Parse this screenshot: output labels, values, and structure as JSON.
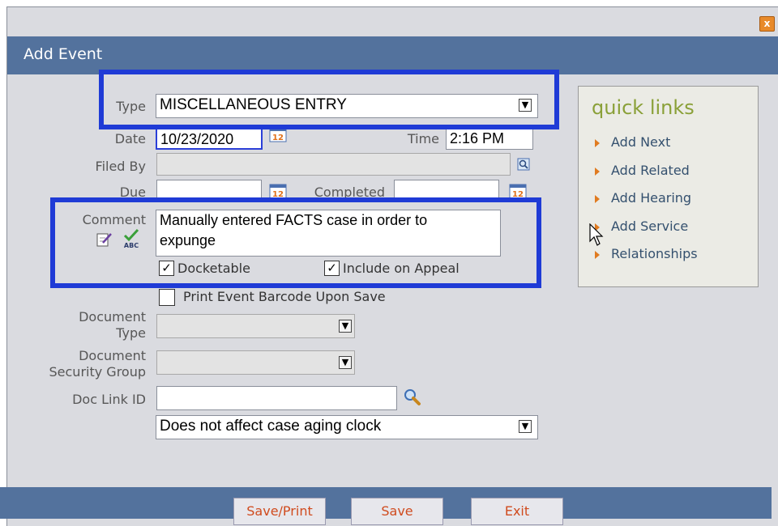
{
  "dialog": {
    "title": "Add Event",
    "close_glyph": "x"
  },
  "form": {
    "type_label": "Type",
    "type_value": "MISCELLANEOUS ENTRY",
    "date_label": "Date",
    "date_value": "10/23/2020",
    "time_label": "Time",
    "time_value": "2:16 PM",
    "filed_by_label": "Filed By",
    "filed_by_value": "",
    "due_label": "Due",
    "due_value": "",
    "completed_label": "Completed",
    "completed_value": "",
    "comment_label": "Comment",
    "comment_line1": "Manually entered FACTS case in order to",
    "comment_line2": "expunge",
    "docketable_label": "Docketable",
    "docketable_checked": true,
    "include_appeal_label": "Include on Appeal",
    "include_appeal_checked": true,
    "print_barcode_label": "Print Event Barcode Upon Save",
    "print_barcode_checked": false,
    "doc_type_label_1": "Document",
    "doc_type_label_2": "Type",
    "doc_type_value": "",
    "doc_sec_label_1": "Document",
    "doc_sec_label_2": "Security Group",
    "doc_sec_value": "",
    "doc_link_label": "Doc Link ID",
    "doc_link_value": "",
    "aging_value": "Does not affect case aging clock",
    "calendar_number": "12",
    "checkmark_glyph": "✓",
    "dropdown_glyph": "▼"
  },
  "quick_links": {
    "title": "quick links",
    "items": [
      {
        "label": "Add Next"
      },
      {
        "label": "Add Related"
      },
      {
        "label": "Add Hearing"
      },
      {
        "label": "Add Service"
      },
      {
        "label": "Relationships"
      }
    ]
  },
  "footer": {
    "save_print": "Save/Print",
    "save": "Save",
    "exit": "Exit"
  },
  "colors": {
    "titlebar": "#53729d",
    "highlight": "#1f3bd6",
    "quicklinks_title": "#8aa038",
    "button_text": "#d04b1e"
  }
}
